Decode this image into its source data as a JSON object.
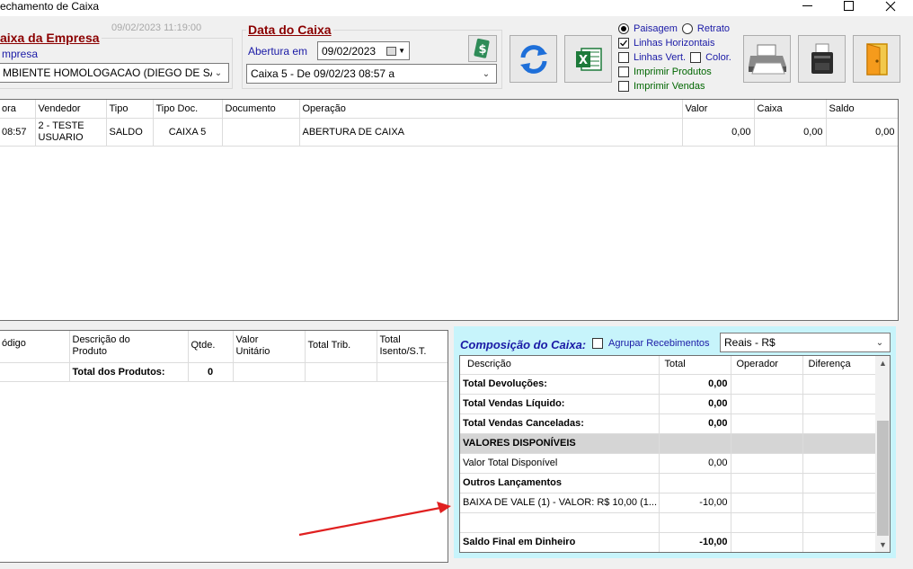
{
  "window": {
    "title": "echamento de Caixa",
    "timestamp": "09/02/2023 11:19:00"
  },
  "empresa": {
    "group_title": "aixa da Empresa",
    "label": "mpresa",
    "selected": "MBIENTE HOMOLOGACAO  (DIEGO DE SAI"
  },
  "data_caixa": {
    "group_title": "Data do Caixa",
    "abertura_label": "Abertura em",
    "abertura_value": "09/02/2023",
    "caixa_selected": "Caixa 5 - De 09/02/23 08:57 a"
  },
  "toolbar": {
    "money_icon": "money-icon",
    "refresh_icon": "refresh-icon",
    "excel_icon": "excel-icon",
    "print_icon": "printer-icon",
    "fiscal_icon": "fiscal-printer-icon",
    "exit_icon": "exit-door-icon"
  },
  "options": {
    "paisagem": "Paisagem",
    "retrato": "Retrato",
    "linhas_horizontais": "Linhas Horizontais",
    "linhas_vert": "Linhas Vert.",
    "color": "Color.",
    "imprimir_produtos": "Imprimir Produtos",
    "imprimir_vendas": "Imprimir Vendas"
  },
  "movimentos": {
    "columns": [
      "ora",
      "Vendedor",
      "Tipo",
      "Tipo Doc.",
      "Documento",
      "Operação",
      "Valor",
      "Caixa",
      "Saldo"
    ],
    "rows": [
      {
        "hora": "08:57",
        "vendedor_1": "2 - TESTE",
        "vendedor_2": "USUARIO",
        "tipo": "SALDO",
        "tipo_doc": "CAIXA 5",
        "documento": "",
        "operacao": "ABERTURA DE CAIXA",
        "valor": "0,00",
        "caixa": "0,00",
        "saldo": "0,00"
      }
    ]
  },
  "produtos": {
    "columns": [
      "ódigo",
      "Descrição do Produto",
      "Qtde.",
      "Valor Unitário",
      "Total Trib.",
      "Total Isento/S.T."
    ],
    "col_desc_1": "Descrição do",
    "col_desc_2": "Produto",
    "col_valor_1": "Valor",
    "col_valor_2": "Unitário",
    "col_isento_1": "Total",
    "col_isento_2": "Isento/S.T.",
    "total_label": "Total dos Produtos:",
    "total_value": "0"
  },
  "composicao": {
    "title": "Composição do Caixa:",
    "agrupar_label": "Agrupar Recebimentos",
    "moeda_selected": "Reais - R$",
    "columns": [
      "Descrição",
      "Total",
      "Operador",
      "Diferença"
    ],
    "rows": [
      {
        "descricao": "Total Devoluções:",
        "total": "0,00",
        "bold": true
      },
      {
        "descricao": "Total Vendas Líquido:",
        "total": "0,00",
        "bold": true
      },
      {
        "descricao": "Total Vendas Canceladas:",
        "total": "0,00",
        "bold": true
      },
      {
        "descricao": "VALORES DISPONÍVEIS",
        "total": "",
        "bold": true,
        "gray": true
      },
      {
        "descricao": "Valor Total Disponível",
        "total": "0,00",
        "bold": false
      },
      {
        "descricao": "Outros Lançamentos",
        "total": "",
        "bold": true
      },
      {
        "descricao": "BAIXA DE VALE (1) - VALOR: R$ 10,00 (1...",
        "total": "-10,00",
        "bold": false
      },
      {
        "descricao": "",
        "total": "",
        "bold": false
      },
      {
        "descricao": "Saldo Final em Dinheiro",
        "total": "-10,00",
        "bold": true
      }
    ]
  },
  "colors": {
    "accent_red": "#8b0000",
    "label_blue": "#1a1aa6",
    "panel_cyan": "#c7f4fb",
    "arrow_red": "#e02020"
  }
}
